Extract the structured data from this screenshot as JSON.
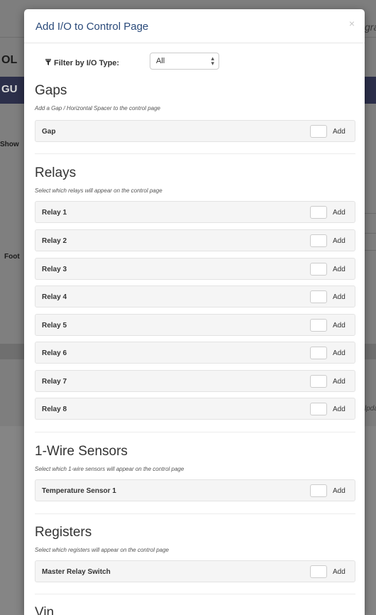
{
  "background": {
    "top_right_text": "gra",
    "title_fragment": "OL",
    "bar_fragment": "GU",
    "show_fragment": "Show",
    "foot_fragment": "Foot",
    "upd_fragment": "lpda"
  },
  "modal": {
    "title": "Add I/O to Control Page",
    "close_label": "×",
    "filter": {
      "icon": "filter-icon",
      "label": "Filter by I/O Type:",
      "selected": "All",
      "arrow": "▴▾"
    },
    "sections": {
      "gaps": {
        "title": "Gaps",
        "description": "Add a Gap / Horizontal Spacer to the control page",
        "items": [
          {
            "label": "Gap",
            "action": "Add"
          }
        ]
      },
      "relays": {
        "title": "Relays",
        "description": "Select which relays will appear on the control page",
        "items": [
          {
            "label": "Relay 1",
            "action": "Add"
          },
          {
            "label": "Relay 2",
            "action": "Add"
          },
          {
            "label": "Relay 3",
            "action": "Add"
          },
          {
            "label": "Relay 4",
            "action": "Add"
          },
          {
            "label": "Relay 5",
            "action": "Add"
          },
          {
            "label": "Relay 6",
            "action": "Add"
          },
          {
            "label": "Relay 7",
            "action": "Add"
          },
          {
            "label": "Relay 8",
            "action": "Add"
          }
        ]
      },
      "sensors": {
        "title": "1-Wire Sensors",
        "description": "Select which 1-wire sensors will appear on the control page",
        "items": [
          {
            "label": "Temperature Sensor 1",
            "action": "Add"
          }
        ]
      },
      "registers": {
        "title": "Registers",
        "description": "Select which registers will appear on the control page",
        "items": [
          {
            "label": "Master Relay Switch",
            "action": "Add"
          }
        ]
      },
      "vin": {
        "title": "Vin"
      }
    }
  },
  "colors": {
    "title_blue": "#2a4a7a",
    "overlay": "#7e7e7e",
    "dark_bar": "#2c2f4a"
  }
}
